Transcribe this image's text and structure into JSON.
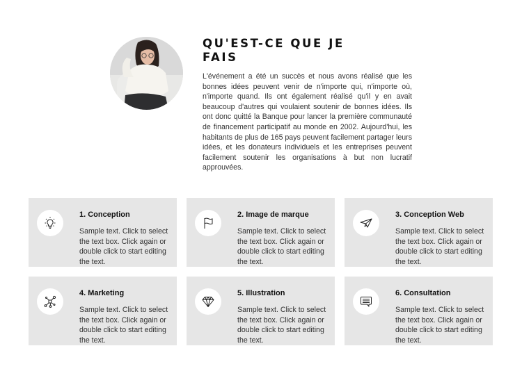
{
  "header": {
    "title": "QU'EST-CE QUE JE FAIS",
    "intro": "L'événement a été un succès et nous avons réalisé que les bonnes idées peuvent venir de n'importe qui, n'importe où, n'importe quand. Ils ont également réalisé qu'il y en avait beaucoup d'autres qui voulaient soutenir de bonnes idées. Ils ont donc quitté la Banque pour lancer la première communauté de financement participatif au monde en 2002. Aujourd'hui, les habitants de plus de 165 pays peuvent facilement partager leurs idées, et les donateurs individuels et les entreprises peuvent facilement soutenir les organisations à but non lucratif approuvées.",
    "avatar_alt": "woman in white sweater"
  },
  "services": [
    {
      "title": "1. Conception",
      "text": "Sample text. Click to select the text box. Click again or double click to start editing the text.",
      "icon": "lightbulb-icon"
    },
    {
      "title": "2. Image de marque",
      "text": "Sample text. Click to select the text box. Click again or double click to start editing the text.",
      "icon": "flag-icon"
    },
    {
      "title": "3. Conception Web",
      "text": "Sample text. Click to select the text box. Click again or double click to start editing the text.",
      "icon": "paper-plane-icon"
    },
    {
      "title": "4. Marketing",
      "text": "Sample text. Click to select the text box. Click again or double click to start editing the text.",
      "icon": "network-icon"
    },
    {
      "title": "5. Illustration",
      "text": "Sample text. Click to select the text box. Click again or double click to start editing the text.",
      "icon": "diamond-icon"
    },
    {
      "title": "6. Consultation",
      "text": "Sample text. Click to select the text box. Click again or double click to start editing the text.",
      "icon": "chat-bubble-icon"
    }
  ],
  "colors": {
    "card_background": "#e6e6e6",
    "icon_circle": "#ffffff",
    "heading": "#111111",
    "body_text": "#333333"
  }
}
